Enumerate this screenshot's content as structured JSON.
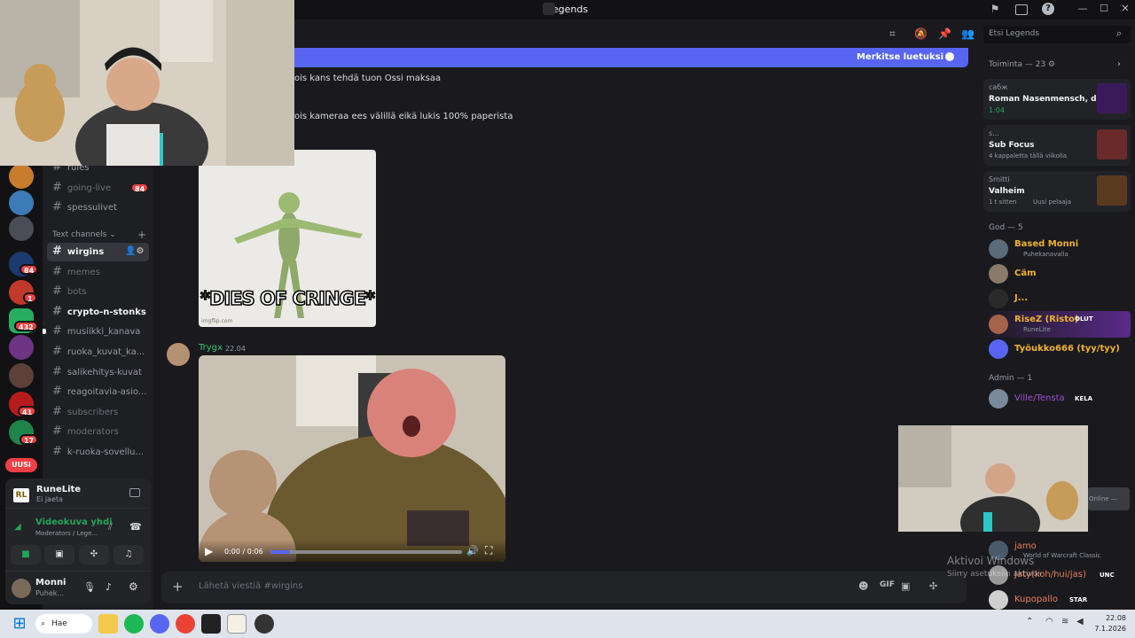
{
  "window": {
    "title": "Legends"
  },
  "servers": {
    "badges": [
      "84",
      "1",
      "432",
      "41",
      "17"
    ],
    "new_label": "UUSI"
  },
  "channels": {
    "top": [
      {
        "name": "rules",
        "style": "normal"
      },
      {
        "name": "going-live",
        "style": "muted",
        "badge": "84"
      },
      {
        "name": "spessulivet",
        "style": "normal"
      }
    ],
    "category": "Text channels",
    "list": [
      {
        "name": "wirgins",
        "style": "selected"
      },
      {
        "name": "memes",
        "style": "muted"
      },
      {
        "name": "bots",
        "style": "muted"
      },
      {
        "name": "crypto-n-stonks",
        "style": "bright"
      },
      {
        "name": "musiikki_kanava",
        "style": "normal"
      },
      {
        "name": "ruoka_kuvat_ka...",
        "style": "normal"
      },
      {
        "name": "salikehitys-kuvat",
        "style": "normal"
      },
      {
        "name": "reagoitavia-asio...",
        "style": "normal"
      },
      {
        "name": "subscribers",
        "style": "muted"
      },
      {
        "name": "moderators",
        "style": "muted"
      },
      {
        "name": "k-ruoka-sovellu...",
        "style": "normal"
      }
    ]
  },
  "activity": {
    "app": "RuneLite",
    "status": "Ei jaeta"
  },
  "voice": {
    "title": "Videokuva yhdi",
    "sub": "Moderators / Lege..."
  },
  "user": {
    "name": "Monni",
    "status": "Puhek..."
  },
  "chat": {
    "mark_read": "Merkitse luetuksi",
    "line1": "ois kans tehdä tuon Ossi maksaa",
    "line2": "ois kameraa ees välillä eikä lukis 100% paperista",
    "meme_caption": "*DIES OF CRINGE*",
    "meme_source": "imgflip.com",
    "author": "Trygx",
    "time": "22.04",
    "video_time": "0:00 / 0:06",
    "video_progress": 0.1,
    "input_placeholder": "Lähetä viestiä #wirgins"
  },
  "search": {
    "placeholder": "Etsi Legends"
  },
  "members": {
    "activity_header": "Toiminta — 23",
    "activities": [
      {
        "user": "сабж",
        "title": "Roman Nasenmensch, dom...",
        "sub": "1:04"
      },
      {
        "user": "s...",
        "title": "Sub Focus",
        "sub": "4 kappaletta tällä viikolla"
      },
      {
        "user": "Smitti",
        "title": "Valheim",
        "sub": "1 t sitten",
        "extra": "Uusi pelaaja"
      }
    ],
    "god_header": "God — 5",
    "god": [
      {
        "name": "Based Monni",
        "sub": "Puhekanavalla",
        "color": "#f0b232"
      },
      {
        "name": "Cäm",
        "sub": "",
        "color": "#f0b232"
      },
      {
        "name": "J...",
        "sub": "",
        "color": "#f0b232"
      },
      {
        "name": "RiseZ (Risto)",
        "sub": "RuneLite",
        "color": "#f0b232",
        "tag": "OLUT"
      },
      {
        "name": "Työukko666 (tyy/tyy)",
        "sub": "",
        "color": "#f0b232"
      }
    ],
    "admin_header": "Admin — 1",
    "admin": [
      {
        "name": "Ville/Tensta",
        "color": "#a24bd6",
        "tag": "KELA"
      }
    ],
    "online_label": "Online —",
    "bottom": [
      {
        "name": "jamo",
        "sub": "World of Warcraft Classic",
        "color": "#e67e5c"
      },
      {
        "name": "Jaty(koh/hui/jas)",
        "color": "#e67e5c",
        "tag": "UNC"
      },
      {
        "name": "Kupopallo",
        "color": "#e67e5c",
        "tag": "STAR"
      }
    ]
  },
  "watermark": {
    "title": "Aktivoi Windows",
    "sub": "Siirry asetuksiin aktivoidaksesi Windowsin."
  },
  "taskbar": {
    "search": "Hae",
    "time": "22.08",
    "date": "7.1.2026"
  },
  "colors": {
    "blurple": "#5865f2",
    "green": "#23a55a",
    "red": "#f23f43"
  }
}
